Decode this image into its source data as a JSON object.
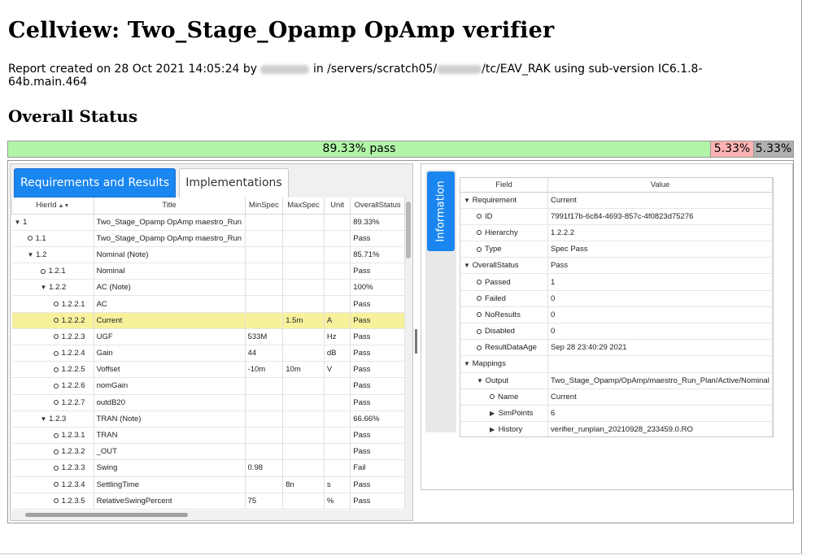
{
  "page": {
    "title": "Cellview: Two_Stage_Opamp OpAmp verifier",
    "report_line": {
      "prefix": "Report created on 28 Oct 2021 14:05:24 by",
      "mid": "in /servers/scratch05/",
      "suffix": "/tc/EAV_RAK using sub-version IC6.1.8-64b.main.464"
    },
    "overall_heading": "Overall Status"
  },
  "status": {
    "pass_label": "89.33% pass",
    "fail_label": "5.33%",
    "noresult_label": "5.33%",
    "pass_fraction": 0.8933,
    "fail_fraction": 0.0533,
    "noresult_fraction": 0.0533,
    "colors": {
      "pass": "#b2f5a9",
      "fail": "#ffb3b3",
      "noresult": "#b0b0b0"
    }
  },
  "tabs": {
    "requirements": "Requirements and Results",
    "implementations": "Implementations",
    "information": "Information"
  },
  "req_table": {
    "headers": {
      "hierid": "HierId",
      "title": "Title",
      "minspec": "MinSpec",
      "maxspec": "MaxSpec",
      "unit": "Unit",
      "status": "OverallStatus"
    },
    "rows": [
      {
        "id": "1",
        "title": "Two_Stage_Opamp OpAmp maestro_Run",
        "min": "",
        "max": "",
        "unit": "",
        "status": "89.33%",
        "state": "fail"
      },
      {
        "id": "1.1",
        "title": "Two_Stage_Opamp OpAmp maestro_Run",
        "min": "",
        "max": "",
        "unit": "",
        "status": "Pass",
        "state": "pass"
      },
      {
        "id": "1.2",
        "title": "Nominal (Note)",
        "min": "",
        "max": "",
        "unit": "",
        "status": "85.71%",
        "state": "fail"
      },
      {
        "id": "1.2.1",
        "title": "Nominal",
        "min": "",
        "max": "",
        "unit": "",
        "status": "Pass",
        "state": "pass"
      },
      {
        "id": "1.2.2",
        "title": "AC (Note)",
        "min": "",
        "max": "",
        "unit": "",
        "status": "100%",
        "state": "pass"
      },
      {
        "id": "1.2.2.1",
        "title": "AC",
        "min": "",
        "max": "",
        "unit": "",
        "status": "Pass",
        "state": "pass"
      },
      {
        "id": "1.2.2.2",
        "title": "Current",
        "min": "",
        "max": "1.5m",
        "unit": "A",
        "status": "Pass",
        "state": "pass"
      },
      {
        "id": "1.2.2.3",
        "title": "UGF",
        "min": "533M",
        "max": "",
        "unit": "Hz",
        "status": "Pass",
        "state": "pass"
      },
      {
        "id": "1.2.2.4",
        "title": "Gain",
        "min": "44",
        "max": "",
        "unit": "dB",
        "status": "Pass",
        "state": "pass"
      },
      {
        "id": "1.2.2.5",
        "title": "Voffset",
        "min": "-10m",
        "max": "10m",
        "unit": "V",
        "status": "Pass",
        "state": "pass"
      },
      {
        "id": "1.2.2.6",
        "title": "nomGain",
        "min": "",
        "max": "",
        "unit": "",
        "status": "Pass",
        "state": "pass"
      },
      {
        "id": "1.2.2.7",
        "title": "outdB20",
        "min": "",
        "max": "",
        "unit": "",
        "status": "Pass",
        "state": "pass"
      },
      {
        "id": "1.2.3",
        "title": "TRAN (Note)",
        "min": "",
        "max": "",
        "unit": "",
        "status": "66.66%",
        "state": "fail"
      },
      {
        "id": "1.2.3.1",
        "title": "TRAN",
        "min": "",
        "max": "",
        "unit": "",
        "status": "Pass",
        "state": "pass"
      },
      {
        "id": "1.2.3.2",
        "title": "_OUT",
        "min": "",
        "max": "",
        "unit": "",
        "status": "Pass",
        "state": "pass"
      },
      {
        "id": "1.2.3.3",
        "title": "Swing",
        "min": "0.98",
        "max": "",
        "unit": "",
        "status": "Fail",
        "state": "fail"
      },
      {
        "id": "1.2.3.4",
        "title": "SettlingTime",
        "min": "",
        "max": "8n",
        "unit": "s",
        "status": "Pass",
        "state": "pass"
      },
      {
        "id": "1.2.3.5",
        "title": "RelativeSwingPercent",
        "min": "75",
        "max": "",
        "unit": "%",
        "status": "Pass",
        "state": "pass"
      }
    ]
  },
  "info_table": {
    "headers": {
      "field": "Field",
      "value": "Value"
    },
    "rows": [
      {
        "field": "Requirement",
        "value": "Current"
      },
      {
        "field": "ID",
        "value": "7991f17b-6c84-4693-857c-4f0823d75276"
      },
      {
        "field": "Hierarchy",
        "value": "1.2.2.2"
      },
      {
        "field": "Type",
        "value": "Spec Pass"
      },
      {
        "field": "OverallStatus",
        "value": "Pass"
      },
      {
        "field": "Passed",
        "value": "1"
      },
      {
        "field": "Failed",
        "value": "0"
      },
      {
        "field": "NoResults",
        "value": "0"
      },
      {
        "field": "Disabled",
        "value": "0"
      },
      {
        "field": "ResultDataAge",
        "value": "Sep 28 23:40:29 2021"
      },
      {
        "field": "Mappings",
        "value": ""
      },
      {
        "field": "Output",
        "value": "Two_Stage_Opamp/OpAmp/maestro_Run_Plan/Active/Nominal"
      },
      {
        "field": "Name",
        "value": "Current"
      },
      {
        "field": "SimPoints",
        "value": "6"
      },
      {
        "field": "History",
        "value": "verifier_runplan_20210928_233459.0.RO"
      }
    ]
  }
}
